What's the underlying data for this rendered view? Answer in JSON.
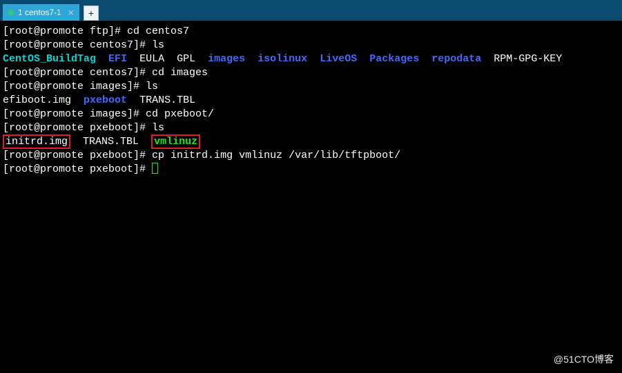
{
  "tabbar": {
    "tab_label": "1 centos7-1",
    "newtab_label": "+"
  },
  "terminal": {
    "lines": [
      {
        "prompt": "[root@promote ftp]# ",
        "cmd": "cd centos7"
      },
      {
        "prompt": "[root@promote centos7]# ",
        "cmd": "ls"
      },
      {
        "listing": [
          {
            "text": "CentOS_BuildTag",
            "cls": "cyan"
          },
          {
            "text": "EFI",
            "cls": "blue"
          },
          {
            "text": "EULA",
            "cls": "white"
          },
          {
            "text": "GPL",
            "cls": "white"
          },
          {
            "text": "images",
            "cls": "blue"
          },
          {
            "text": "isolinux",
            "cls": "blue"
          },
          {
            "text": "LiveOS",
            "cls": "blue"
          },
          {
            "text": "Packages",
            "cls": "blue"
          },
          {
            "text": "repodata",
            "cls": "blue"
          },
          {
            "text": "RPM-GPG-KEY",
            "cls": "white"
          }
        ]
      },
      {
        "prompt": "[root@promote centos7]# ",
        "cmd": "cd images"
      },
      {
        "prompt": "[root@promote images]# ",
        "cmd": "ls"
      },
      {
        "listing": [
          {
            "text": "efiboot.img",
            "cls": "white"
          },
          {
            "text": "pxeboot",
            "cls": "blue"
          },
          {
            "text": "TRANS.TBL",
            "cls": "white"
          }
        ]
      },
      {
        "prompt": "[root@promote images]# ",
        "cmd": "cd pxeboot/"
      },
      {
        "prompt": "[root@promote pxeboot]# ",
        "cmd": "ls"
      },
      {
        "listing": [
          {
            "text": "initrd.img",
            "cls": "white",
            "boxed": true
          },
          {
            "text": "TRANS.TBL",
            "cls": "white"
          },
          {
            "text": "vmlinuz",
            "cls": "green",
            "boxed": true
          }
        ]
      },
      {
        "prompt": "[root@promote pxeboot]# ",
        "cmd": "cp initrd.img vmlinuz /var/lib/tftpboot/"
      },
      {
        "prompt": "[root@promote pxeboot]# ",
        "cmd": "",
        "cursor": true
      }
    ]
  },
  "watermark": "@51CTO博客"
}
